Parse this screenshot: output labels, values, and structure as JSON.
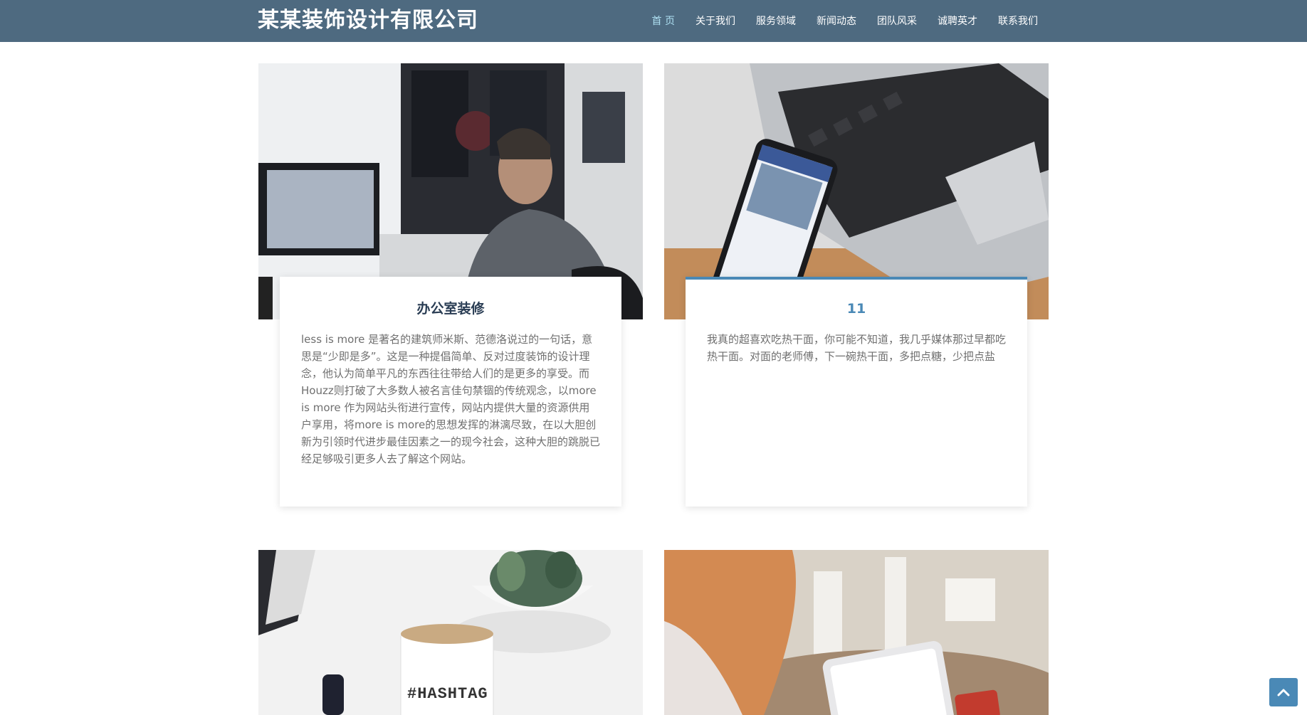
{
  "header": {
    "brand": "某某装饰设计有限公司",
    "nav": [
      "首 页",
      "关于我们",
      "服务领域",
      "新闻动态",
      "团队风采",
      "诚聘英才",
      "联系我们"
    ],
    "active_index": 0
  },
  "cards": [
    {
      "title": "办公室装修",
      "text": "less is more 是著名的建筑师米斯、范德洛说过的一句话，意思是“少即是多”。这是一种提倡简单、反对过度装饰的设计理念，他认为简单平凡的东西往往带给人们的是更多的享受。而Houzz则打破了大多数人被名言佳句禁锢的传统观念，以more is more 作为网站头衔进行宣传，网站内提供大量的资源供用户享用，将more is more的思想发挥的淋漓尽致，在以大胆创新为引领时代进步最佳因素之一的现今社会，这种大胆的跳脱已经足够吸引更多人去了解这个网站。"
    },
    {
      "title": "11",
      "text": "我真的超喜欢吃热干面，你可能不知道，我几乎媒体那过早都吃热干面。对面的老师傅，下一碗热干面，多把点糖，少把点盐"
    }
  ],
  "images": [
    {
      "icon": "office-man-monitor-photo"
    },
    {
      "icon": "laptop-phone-facebook-photo"
    },
    {
      "icon": "coffee-mug-hashtag-photo"
    },
    {
      "icon": "woman-tablet-photo"
    }
  ],
  "mug_text": "#HASHTAG",
  "colors": {
    "header_bg": "#4e6a80",
    "nav_active": "#aee0f2",
    "title_dark": "#2a3d54",
    "title_accent": "#4a89b6",
    "back_top_bg": "#4a89b6"
  }
}
